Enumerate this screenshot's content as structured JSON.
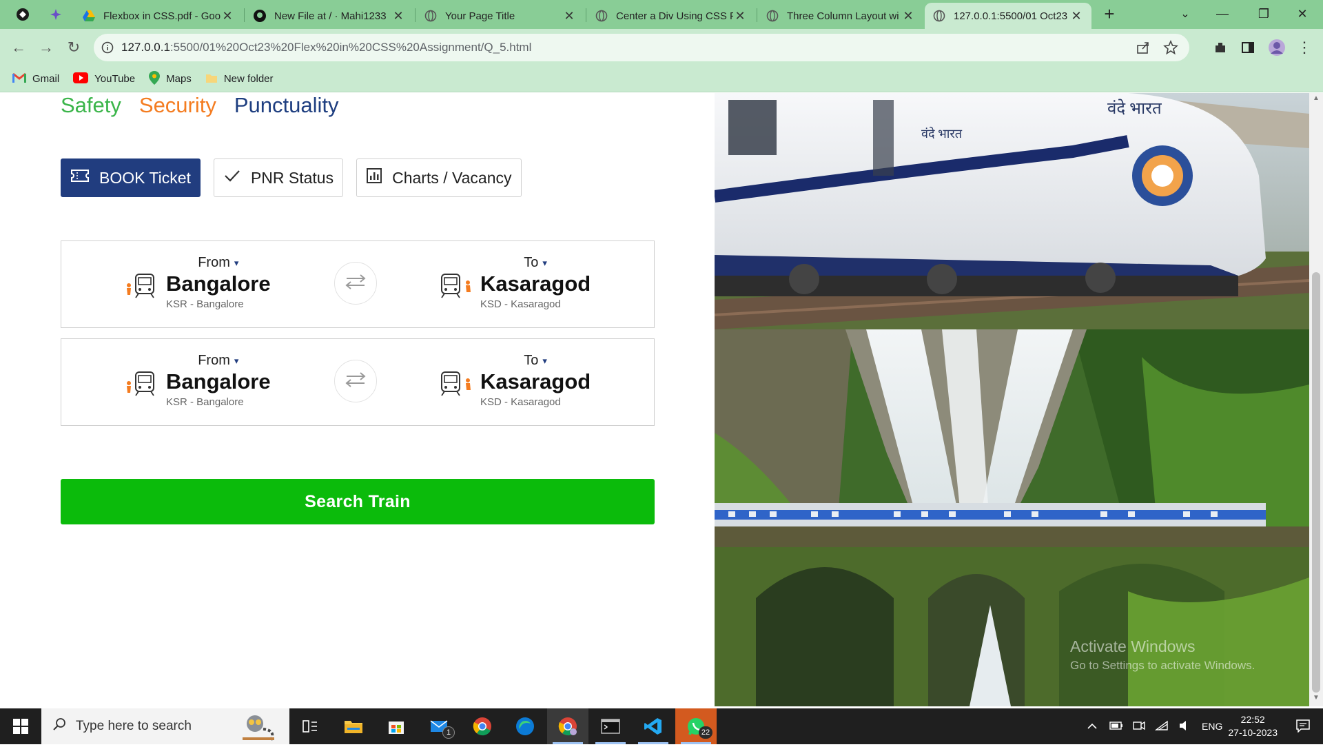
{
  "browser": {
    "tabs": [
      {
        "title": "Flexbox in CSS.pdf - Goo",
        "favicon": "google-drive-icon"
      },
      {
        "title": "New File at / · Mahi1233",
        "favicon": "github-icon"
      },
      {
        "title": "Your Page Title",
        "favicon": "globe-icon"
      },
      {
        "title": "Center a Div Using CSS F",
        "favicon": "globe-icon"
      },
      {
        "title": "Three Column Layout wi",
        "favicon": "globe-icon"
      },
      {
        "title": "127.0.0.1:5500/01 Oct23",
        "favicon": "globe-icon",
        "active": true
      }
    ],
    "url_host": "127.0.0.1",
    "url_path": ":5500/01%20Oct23%20Flex%20in%20CSS%20Assignment/Q_5.html",
    "bookmarks": [
      {
        "label": "Gmail",
        "icon": "gmail-icon"
      },
      {
        "label": "YouTube",
        "icon": "youtube-icon"
      },
      {
        "label": "Maps",
        "icon": "maps-icon"
      },
      {
        "label": "New folder",
        "icon": "folder-icon"
      }
    ],
    "theme_color": "#89cd96"
  },
  "page": {
    "tagline": {
      "safety": "Safety",
      "security": "Security",
      "punctuality": "Punctuality"
    },
    "actions": {
      "book": "BOOK Ticket",
      "pnr": "PNR Status",
      "charts": "Charts / Vacancy"
    },
    "routes": [
      {
        "from_label": "From",
        "from_city": "Bangalore",
        "from_code": "KSR - Bangalore",
        "to_label": "To",
        "to_city": "Kasaragod",
        "to_code": "KSD - Kasaragod"
      },
      {
        "from_label": "From",
        "from_city": "Bangalore",
        "from_code": "KSR - Bangalore",
        "to_label": "To",
        "to_city": "Kasaragod",
        "to_code": "KSD - Kasaragod"
      }
    ],
    "search_button": "Search Train",
    "colors": {
      "primary": "#213d7f",
      "search": "#0bbb0b",
      "safety": "#3bb54a",
      "security": "#f47c20"
    }
  },
  "watermark": {
    "line1": "Activate Windows",
    "line2": "Go to Settings to activate Windows."
  },
  "taskbar": {
    "search_placeholder": "Type here to search",
    "mail_badge": "1",
    "whatsapp_badge": "22",
    "language": "ENG",
    "time": "22:52",
    "date": "27-10-2023"
  }
}
